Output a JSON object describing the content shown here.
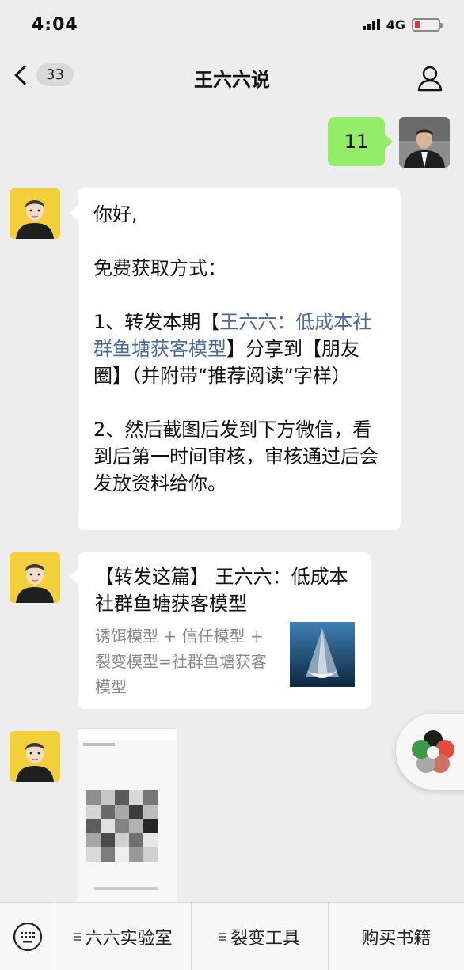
{
  "status_bar": {
    "time": "4:04",
    "network": "4G"
  },
  "nav": {
    "back_count": "33",
    "title": "王六六说"
  },
  "messages": {
    "self_text": "11",
    "greeting": {
      "line1": "你好,",
      "line2": "免费获取方式：",
      "line3_prefix": "1、转发本期【",
      "line3_link": "王六六：低成本社群鱼塘获客模型",
      "line3_suffix": "】分享到【朋友圈】（并附带“推荐阅读”字样）",
      "line4": "2、然后截图后发到下方微信，看到后第一时间审核，审核通过后会发放资料给你。"
    },
    "card": {
      "title": "【转发这篇】 王六六：低成本社群鱼塘获客模型",
      "desc": "诱饵模型 + 信任模型 + 裂变模型=社群鱼塘获客模型"
    }
  },
  "bottom_menu": {
    "item1": "六六实验室",
    "item2": "裂变工具",
    "item3": "购买书籍"
  },
  "colors": {
    "self_bubble": "#95ec69",
    "link": "#4a6a9a",
    "background": "#ededed"
  }
}
